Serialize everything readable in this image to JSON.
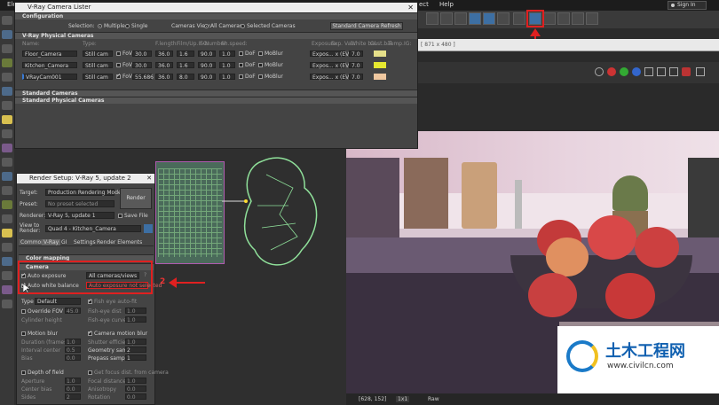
{
  "menubar": {
    "items": [
      "Ele",
      "ect",
      "Help"
    ],
    "signin": "Sign In"
  },
  "lister": {
    "title": "V-Ray Camera Lister",
    "config_section": "Configuration",
    "selection_label": "Selection:",
    "multiple": "Multiple",
    "single": "Single",
    "cameras_view_label": "Cameras View:",
    "all_cameras": "All Cameras",
    "selected_cameras": "Selected Cameras",
    "refresh": "Standard Camera Refresh",
    "physical_section": "V-Ray Physical Cameras",
    "columns": [
      "Name:",
      "Type:",
      "F.length:",
      "Film/Up.ISO:",
      "F-Number:",
      "Sh.speed:",
      "Exposure:",
      "Exp. Val.:",
      "White bal.",
      "Cust.bal.",
      "Temp.",
      "IG:"
    ],
    "rows": [
      {
        "name": "Floor_Camera",
        "type": "Still cam",
        "fov": "FoV",
        "a": "30.0",
        "b": "36.0",
        "c": "1.6",
        "d": "90.0",
        "e": "1.0",
        "dof": "DoF",
        "mo": "MoBlur",
        "exp": "Expos... x (EV)",
        "ev": "7.0",
        "color": "#e6e08a"
      },
      {
        "name": "Kitchen_Camera",
        "type": "Still cam",
        "fov": "FoV",
        "a": "30.0",
        "b": "36.0",
        "c": "1.6",
        "d": "90.0",
        "e": "1.0",
        "dof": "DoF",
        "mo": "MoBlur",
        "exp": "Expos... x (EV)",
        "ev": "7.0",
        "color": "#e6e830"
      },
      {
        "name": "VRayCam001",
        "type": "Still cam",
        "fov": "FoV",
        "a": "55.686",
        "b": "36.0",
        "c": "8.0",
        "d": "90.0",
        "e": "1.0",
        "dof": "DoF",
        "mo": "MoBlur",
        "exp": "Expos... x (EV)",
        "ev": "7.0",
        "color": "#f0c8a0"
      }
    ],
    "std_section": "Standard Cameras",
    "std_phys_section": "Standard Physical Cameras"
  },
  "render": {
    "title": "Render Setup: V-Ray 5, update 2",
    "target_label": "Target:",
    "target": "Production Rendering Mode",
    "preset_label": "Preset:",
    "preset": "No preset selected",
    "renderer_label": "Renderer:",
    "renderer": "V-Ray 5, update 1",
    "save_file": "Save File",
    "render_button": "Render",
    "view_label": "View to\nRender:",
    "view": "Quad 4 - Kitchen_Camera",
    "tabs": [
      "Common",
      "V-Ray",
      "GI",
      "Settings",
      "Render Elements"
    ],
    "color_mapping": "Color mapping",
    "camera_section": "Camera",
    "auto_exposure": "Auto exposure",
    "auto_exposure_value": "All cameras/views",
    "auto_wb": "Auto white balance",
    "auto_wb_value": "Auto exposure not selected",
    "annotation": "2",
    "type_label": "Type",
    "type_value": "Default",
    "fisheye": "Fish eye auto-fit",
    "override_fov": "Override FOV",
    "fov_val": "45.0",
    "fisheye_dist": "Fish-eye dist",
    "fisheye_curve": "Fish-eye curve",
    "cyl_height": "Cylinder height",
    "motion_blur": "Motion blur",
    "camera_mb": "Camera motion blur",
    "duration": "Duration (frames)",
    "shutter": "Shutter efficiency",
    "interval": "Interval center",
    "geom_samples": "Geometry samples",
    "bias": "Bias",
    "prepass": "Prepass samples",
    "dof": "Depth of field",
    "from_camera": "Get focus dist. from camera",
    "aperture": "Aperture",
    "focal_dist": "Focal distance",
    "center_bias": "Center bias",
    "anisotropy": "Anisotropy",
    "sides": "Sides",
    "rotation": "Rotation",
    "values": {
      "v1": "1.0",
      "v2": "0.5",
      "v3": "0.0",
      "v4": "1.0",
      "v5": "2",
      "v6": "1"
    }
  },
  "viewport": {
    "label": "[ 871 x 480 ]",
    "stats": "[628, 152]",
    "ratio": "1x1",
    "colors": "Raw"
  },
  "watermark": {
    "site": "土木工程网",
    "url": "www.civilcn.com"
  }
}
